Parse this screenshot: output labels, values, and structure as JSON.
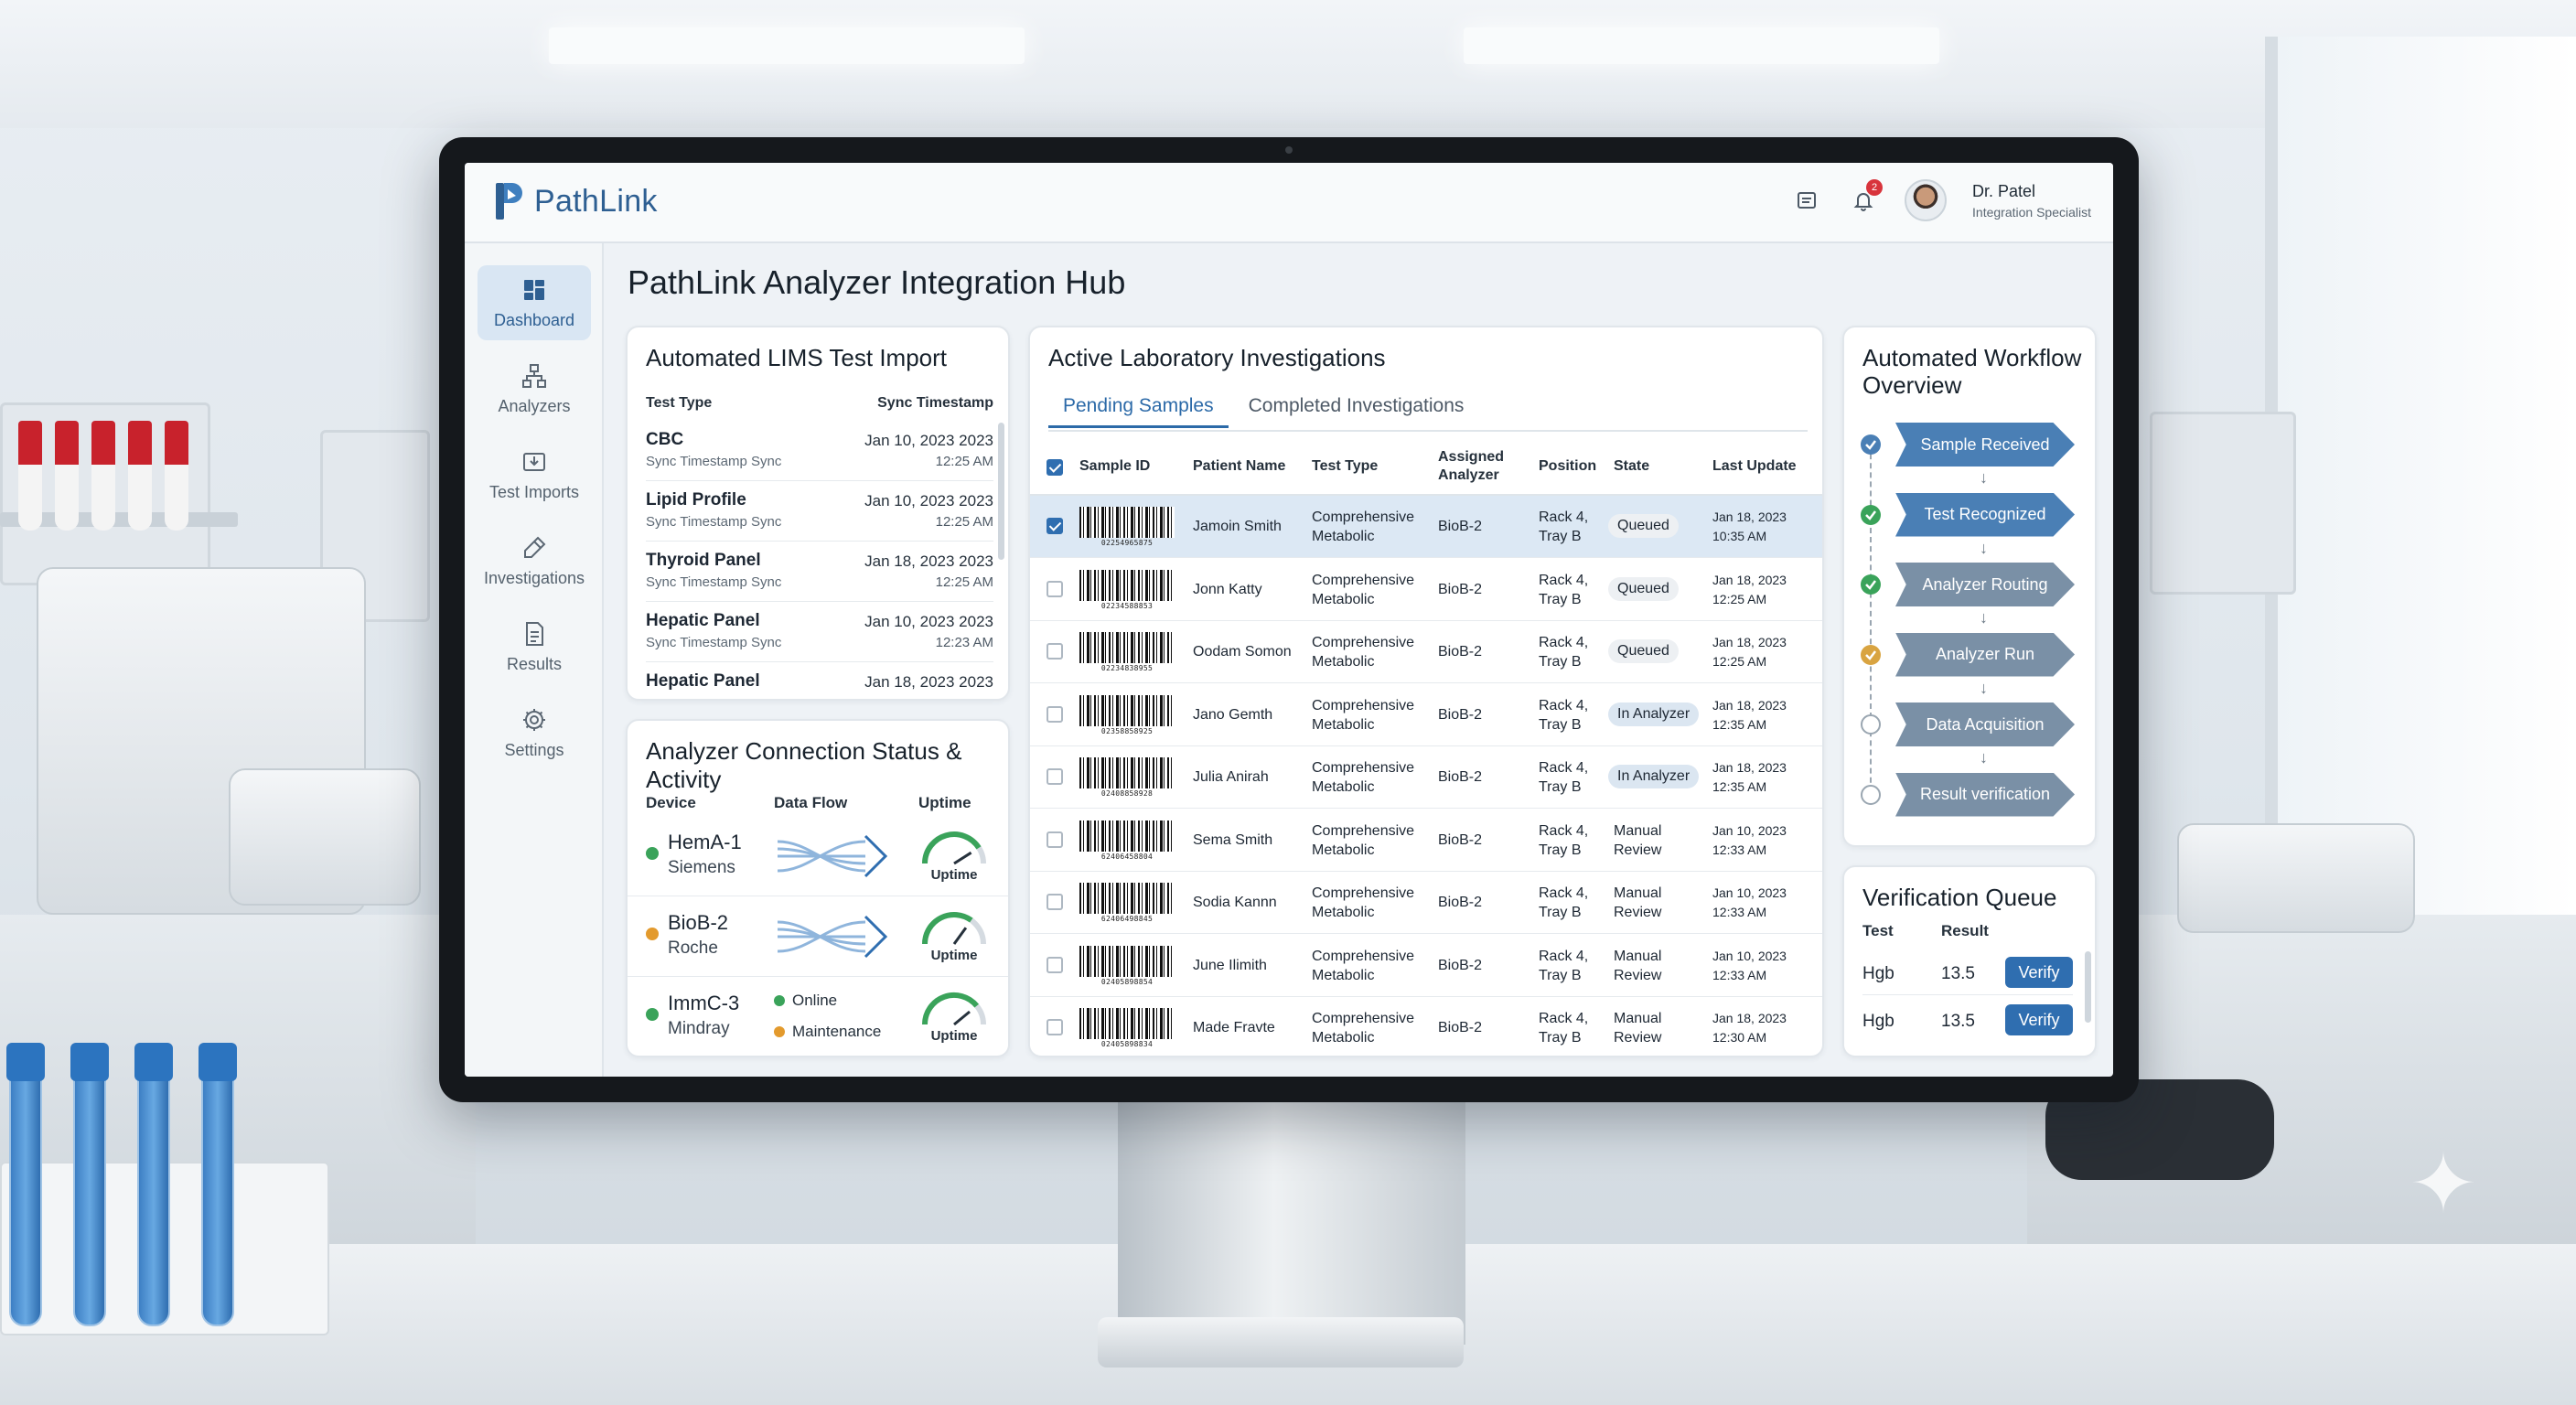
{
  "app": {
    "brand": "PathLink",
    "page_title": "PathLink Analyzer Integration Hub",
    "notifications_count": "2",
    "user": {
      "name": "Dr. Patel",
      "role": "Integration Specialist"
    }
  },
  "sidebar": {
    "items": [
      {
        "label": "Dashboard",
        "icon": "dashboard-icon",
        "active": true
      },
      {
        "label": "Analyzers",
        "icon": "analyzers-icon"
      },
      {
        "label": "Test Imports",
        "icon": "test-imports-icon"
      },
      {
        "label": "Investigations",
        "icon": "investigations-icon"
      },
      {
        "label": "Results",
        "icon": "results-icon"
      },
      {
        "label": "Settings",
        "icon": "settings-icon"
      }
    ]
  },
  "lims": {
    "title": "Automated LIMS Test Import",
    "col_test_type": "Test Type",
    "col_sync": "Sync Timestamp",
    "rows": [
      {
        "name": "CBC",
        "sub": "Sync Timestamp Sync",
        "date": "Jan 10, 2023 2023",
        "time": "12:25 AM"
      },
      {
        "name": "Lipid Profile",
        "sub": "Sync Timestamp Sync",
        "date": "Jan 10, 2023 2023",
        "time": "12:25 AM"
      },
      {
        "name": "Thyroid Panel",
        "sub": "Sync Timestamp Sync",
        "date": "Jan 18, 2023 2023",
        "time": "12:25 AM"
      },
      {
        "name": "Hepatic Panel",
        "sub": "Sync Timestamp Sync",
        "date": "Jan 10, 2023 2023",
        "time": "12:23 AM"
      },
      {
        "name": "Hepatic Panel",
        "sub": "",
        "date": "Jan 18, 2023 2023",
        "time": ""
      }
    ]
  },
  "analyzer_status": {
    "title": "Analyzer Connection Status & Activity",
    "col_device": "Device",
    "col_flow": "Data Flow",
    "col_uptime": "Uptime",
    "devices": [
      {
        "name": "HemA-1",
        "vendor": "Siemens",
        "status_color": "#3aa35a",
        "uptime_label": "Uptime",
        "uptime_fraction": 0.82
      },
      {
        "name": "BioB-2",
        "vendor": "Roche",
        "status_color": "#e39a2d",
        "uptime_label": "Uptime",
        "uptime_fraction": 0.7
      },
      {
        "name": "ImmC-3",
        "vendor": "Mindray",
        "status_color": "#3aa35a",
        "uptime_label": "Uptime",
        "uptime_fraction": 0.78
      }
    ],
    "legend": {
      "online": "Online",
      "maintenance": "Maintenance",
      "online_color": "#3aa35a",
      "maintenance_color": "#e39a2d"
    }
  },
  "investigations": {
    "title": "Active Laboratory Investigations",
    "tabs": [
      {
        "label": "Pending Samples",
        "active": true
      },
      {
        "label": "Completed Investigations"
      }
    ],
    "columns": {
      "sample_id": "Sample ID",
      "patient": "Patient Name",
      "test_type": "Test Type",
      "analyzer": "Assigned Analyzer",
      "position": "Position",
      "state": "State",
      "last_update": "Last Update"
    },
    "rows": [
      {
        "checked": true,
        "barcode": "02254965875",
        "patient": "Jamoin Smith",
        "test": "Comprehensive Metabolic",
        "analyzer": "BioB-2",
        "position": "Rack 4, Tray B",
        "state": "Queued",
        "date": "Jan 18, 2023",
        "time": "10:35 AM"
      },
      {
        "checked": false,
        "barcode": "02234588853",
        "patient": "Jonn Katty",
        "test": "Comprehensive Metabolic",
        "analyzer": "BioB-2",
        "position": "Rack 4, Tray B",
        "state": "Queued",
        "date": "Jan 18, 2023",
        "time": "12:25 AM"
      },
      {
        "checked": false,
        "barcode": "02234838955",
        "patient": "Oodam Somon",
        "test": "Comprehensive Metabolic",
        "analyzer": "BioB-2",
        "position": "Rack 4, Tray B",
        "state": "Queued",
        "date": "Jan 18, 2023",
        "time": "12:25 AM"
      },
      {
        "checked": false,
        "barcode": "02358858925",
        "patient": "Jano Gemth",
        "test": "Comprehensive Metabolic",
        "analyzer": "BioB-2",
        "position": "Rack 4, Tray B",
        "state": "In Analyzer",
        "date": "Jan 18, 2023",
        "time": "12:35 AM"
      },
      {
        "checked": false,
        "barcode": "02408858928",
        "patient": "Julia Anirah",
        "test": "Comprehensive Metabolic",
        "analyzer": "BioB-2",
        "position": "Rack 4, Tray B",
        "state": "In Analyzer",
        "date": "Jan 18, 2023",
        "time": "12:35 AM"
      },
      {
        "checked": false,
        "barcode": "62406458804",
        "patient": "Sema Smith",
        "test": "Comprehensive Metabolic",
        "analyzer": "BioB-2",
        "position": "Rack 4, Tray B",
        "state": "Manual Review",
        "date": "Jan 10, 2023",
        "time": "12:33 AM"
      },
      {
        "checked": false,
        "barcode": "62406498845",
        "patient": "Sodia Kannn",
        "test": "Comprehensive Metabolic",
        "analyzer": "BioB-2",
        "position": "Rack 4, Tray B",
        "state": "Manual Review",
        "date": "Jan 10, 2023",
        "time": "12:33 AM"
      },
      {
        "checked": false,
        "barcode": "02405898854",
        "patient": "June Ilimith",
        "test": "Comprehensive Metabolic",
        "analyzer": "BioB-2",
        "position": "Rack 4, Tray B",
        "state": "Manual Review",
        "date": "Jan 10, 2023",
        "time": "12:33 AM"
      },
      {
        "checked": false,
        "barcode": "02405898834",
        "patient": "Made Fravte",
        "test": "Comprehensive Metabolic",
        "analyzer": "BioB-2",
        "position": "Rack 4, Tray B",
        "state": "Manual Review",
        "date": "Jan 18, 2023",
        "time": "12:30 AM"
      }
    ]
  },
  "workflow": {
    "title": "Automated Workflow Overview",
    "steps": [
      {
        "label": "Sample Received",
        "status": "done",
        "color": "#4a7fb5"
      },
      {
        "label": "Test Recognized",
        "status": "done",
        "color": "#4a7fb5"
      },
      {
        "label": "Analyzer Routing",
        "status": "done",
        "color": "#7a90a6"
      },
      {
        "label": "Analyzer Run",
        "status": "active",
        "color": "#7a90a6"
      },
      {
        "label": "Data Acquisition",
        "status": "pending",
        "color": "#7a90a6"
      },
      {
        "label": "Result verification",
        "status": "pending",
        "color": "#7a90a6"
      }
    ]
  },
  "verification": {
    "title": "Verification Queue",
    "col_test": "Test",
    "col_result": "Result",
    "rows": [
      {
        "test": "Hgb",
        "result": "13.5",
        "button": "Verify"
      },
      {
        "test": "Hgb",
        "result": "13.5",
        "button": "Verify"
      }
    ]
  }
}
